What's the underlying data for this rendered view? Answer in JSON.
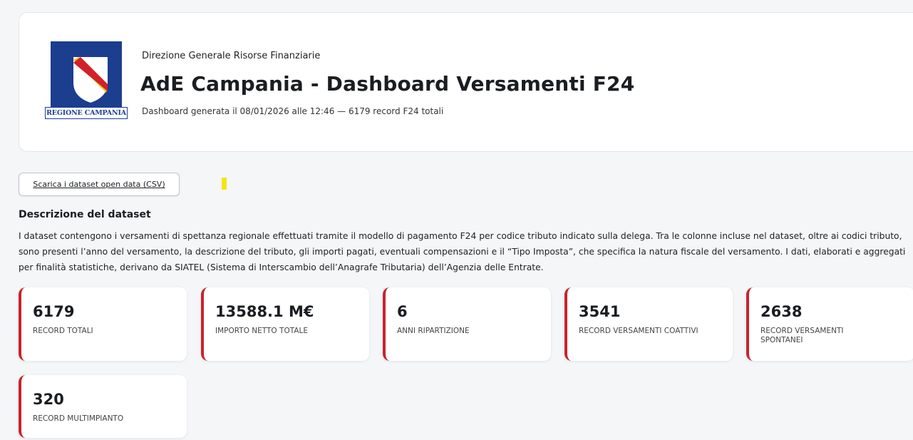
{
  "header": {
    "logo_caption": "REGIONE CAMPANIA",
    "org": "Direzione Generale Risorse Finanziarie",
    "title": "AdE Campania - Dashboard Versamenti F24",
    "meta": "Dashboard generata il 08/01/2026 alle 12:46 — 6179 record F24 totali"
  },
  "actions": {
    "download_label": "Scarica i dataset open data (CSV)"
  },
  "description": {
    "title": "Descrizione del dataset",
    "text": "I dataset contengono i versamenti di spettanza regionale effettuati tramite il modello di pagamento F24 per codice tributo indicato sulla delega. Tra le colonne incluse nel dataset, oltre ai codici tributo, sono presenti l’anno del versamento, la descrizione del tributo, gli importi pagati, eventuali compensazioni e il “Tipo Imposta”, che specifica la natura fiscale del versamento. I dati, elaborati e aggregati per finalità statistiche, derivano da SIATEL (Sistema di Interscambio dell’Anagrafe Tributaria) dell’Agenzia delle Entrate."
  },
  "kpis": [
    {
      "value": "6179",
      "label": "RECORD TOTALI"
    },
    {
      "value": "13588.1 M€",
      "label": "IMPORTO NETTO TOTALE"
    },
    {
      "value": "6",
      "label": "ANNI RIPARTIZIONE"
    },
    {
      "value": "3541",
      "label": "RECORD VERSAMENTI COATTIVI"
    },
    {
      "value": "2638",
      "label": "RECORD VERSAMENTI SPONTANEI"
    },
    {
      "value": "320",
      "label": "RECORD MULTIMPIANTO"
    }
  ],
  "colors": {
    "accent": "#c8232c",
    "logo_blue": "#1c3e8f",
    "logo_band_red": "#d42027",
    "logo_band_gold": "#f2c318",
    "marker_yellow": "#f5e417"
  }
}
